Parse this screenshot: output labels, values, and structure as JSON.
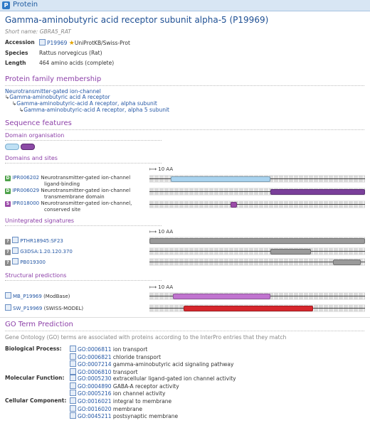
{
  "header": {
    "icon_letter": "P",
    "title": "Protein"
  },
  "protein": {
    "title": "Gamma-aminobutyric acid receptor subunit alpha-5 (P19969)",
    "short_name": "Short name: GBRA5_RAT",
    "accession_label": "Accession",
    "accession": "P19969",
    "accession_db": "UniProtKB/Swiss-Prot",
    "species_label": "Species",
    "species": "Rattus norvegicus (Rat)",
    "length_label": "Length",
    "length": "464 amino acids (complete)"
  },
  "family": {
    "heading": "Protein family membership",
    "items": [
      "Neurotransmitter-gated ion-channel",
      "Gamma-aminobutyric acid A receptor",
      "Gamma-aminobutyric-acid A receptor, alpha subunit",
      "Gamma-aminobutyric-acid A receptor, alpha 5 subunit"
    ]
  },
  "features": {
    "heading": "Sequence features",
    "domain_org": "Domain organisation",
    "domains_sites": "Domains and sites",
    "scale_label": "10 AA",
    "domain_rows": [
      {
        "badge": "D",
        "id": "IPR006202",
        "desc1": "Neurotransmitter-gated ion-channel",
        "desc2": "ligand-binding",
        "color": "#a9d3ef",
        "start": 0.1,
        "end": 0.56
      },
      {
        "badge": "D",
        "id": "IPR006029",
        "desc1": "Neurotransmitter-gated ion-channel",
        "desc2": "transmembrane domain",
        "color": "#7a3f9a",
        "start": 0.56,
        "end": 1.0
      },
      {
        "badge": "S",
        "id": "IPR018000",
        "desc1": "Neurotransmitter-gated ion-channel,",
        "desc2": "conserved site",
        "color": "#9b4aa8",
        "start": 0.375,
        "end": 0.405
      }
    ],
    "unintegrated": "Unintegrated signatures",
    "unint_rows": [
      {
        "badge": "?",
        "id": "PTHR18945:SF23",
        "color": "#9a9a9a",
        "start": 0.0,
        "end": 1.0
      },
      {
        "badge": "?",
        "id": "G3DSA:1.20.120.370",
        "color": "#9a9a9a",
        "start": 0.56,
        "end": 0.75
      },
      {
        "badge": "?",
        "id": "PB019300",
        "color": "#9a9a9a",
        "start": 0.85,
        "end": 0.98
      }
    ],
    "structural": "Structural predictions",
    "struct_rows": [
      {
        "id": "MB_P19969",
        "note": "(ModBase)",
        "color": "#c074cf",
        "start": 0.11,
        "end": 0.56
      },
      {
        "id": "SW_P19969",
        "note": "(SWISS-MODEL)",
        "color": "#d6262c",
        "start": 0.16,
        "end": 0.76
      }
    ]
  },
  "go": {
    "heading": "GO Term Prediction",
    "desc": "Gene Ontology (GO) terms are associated with proteins according to the InterPro entries that they match",
    "groups": [
      {
        "label": "Biological Process:",
        "terms": [
          {
            "id": "GO:0006811",
            "name": "ion transport"
          },
          {
            "id": "GO:0006821",
            "name": "chloride transport"
          },
          {
            "id": "GO:0007214",
            "name": "gamma-aminobutyric acid signaling pathway"
          },
          {
            "id": "GO:0006810",
            "name": "transport"
          }
        ]
      },
      {
        "label": "Molecular Function:",
        "terms": [
          {
            "id": "GO:0005230",
            "name": "extracellular ligand-gated ion channel activity"
          },
          {
            "id": "GO:0004890",
            "name": "GABA-A receptor activity"
          },
          {
            "id": "GO:0005216",
            "name": "ion channel activity"
          }
        ]
      },
      {
        "label": "Cellular Component:",
        "terms": [
          {
            "id": "GO:0016021",
            "name": "integral to membrane"
          },
          {
            "id": "GO:0016020",
            "name": "membrane"
          },
          {
            "id": "GO:0045211",
            "name": "postsynaptic membrane"
          }
        ]
      }
    ]
  }
}
